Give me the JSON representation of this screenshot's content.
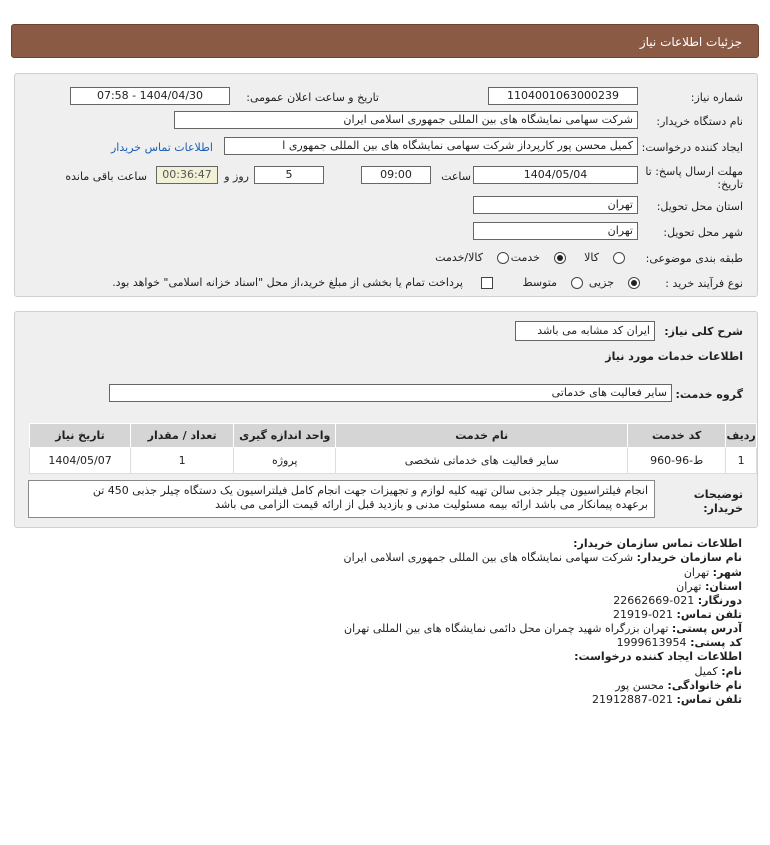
{
  "header": {
    "title": "جزئیات اطلاعات نیاز"
  },
  "form": {
    "need_number_label": "شماره نیاز:",
    "need_number": "1104001063000239",
    "announce_label": "تاریخ و ساعت اعلان عمومی:",
    "announce_value": "1404/04/30 - 07:58",
    "buyer_org_label": "نام دستگاه خریدار:",
    "buyer_org": "شرکت سهامی نمایشگاه های بین المللی جمهوری اسلامی ایران",
    "creator_label": "ایجاد کننده درخواست:",
    "creator": "کمیل محسن پور کارپرداز شرکت سهامی نمایشگاه های بین المللی جمهوری ا",
    "contact_link": "اطلاعات تماس خریدار",
    "deadline_label_1": "مهلت ارسال پاسخ: تا",
    "deadline_label_2": "تاریخ:",
    "deadline_date": "1404/05/04",
    "time_label": "ساعت",
    "deadline_time": "09:00",
    "days_value": "5",
    "days_label": "روز و",
    "remaining": "00:36:47",
    "remaining_label": "ساعت باقی مانده",
    "province_label": "استان محل تحویل:",
    "province": "تهران",
    "city_label": "شهر محل تحویل:",
    "city": "تهران",
    "category_label": "طبقه بندی موضوعی:",
    "category_options": [
      "کالا",
      "خدمت",
      "کالا/خدمت"
    ],
    "category_selected": "خدمت",
    "process_label": "نوع فرآیند خرید :",
    "process_options": [
      "جزیی",
      "متوسط"
    ],
    "process_selected": "جزیی",
    "payment_note": "پرداخت تمام یا بخشی از مبلغ خرید،از محل \"اسناد خزانه اسلامی\" خواهد بود."
  },
  "summary": {
    "label": "شرح کلی نیاز:",
    "value": "ایران کد مشابه می باشد",
    "services_title": "اطلاعات خدمات مورد نیاز",
    "group_label": "گروه خدمت:",
    "group_value": "سایر فعالیت های خدماتی",
    "table": {
      "headers": [
        "ردیف",
        "کد خدمت",
        "نام خدمت",
        "واحد اندازه گیری",
        "تعداد / مقدار",
        "تاریخ نیاز"
      ],
      "rows": [
        [
          "1",
          "ط-96-960",
          "سایر فعالیت های خدماتی شخصی",
          "پروژه",
          "1",
          "1404/05/07"
        ]
      ]
    },
    "buyer_notes_label_1": "توضیحات",
    "buyer_notes_label_2": "خریدار:",
    "buyer_notes_line1": "انجام فیلتراسیون چیلر جذبی سالن تهیه کلیه لوازم و تجهیزات جهت انجام کامل فیلتراسیون یک دستگاه چیلر جذبی 450 تن",
    "buyer_notes_line2": "برعهده پیمانکار می باشد ارائه بیمه مسئولیت مدنی و بازدید قبل از ارائه قیمت الزامی می باشد"
  },
  "contact": {
    "buyer_title": "اطلاعات تماس سازمان خریدار:",
    "org_label": "نام سازمان خریدار:",
    "org_value": "شرکت سهامی نمایشگاه های بین المللی جمهوری اسلامی ایران",
    "city_label": "شهر:",
    "city_value": "تهران",
    "province_label": "استان:",
    "province_value": "تهران",
    "fax_label": "دورنگار:",
    "fax_value": "021-22662669",
    "phone_label": "تلفن تماس:",
    "phone_value": "021-21919",
    "address_label": "آدرس پستی:",
    "address_value": "تهران بزرگراه شهید چمران محل دائمی نمایشگاه های بین المللی تهران",
    "postal_label": "کد پستی:",
    "postal_value": "1999613954",
    "creator_title": "اطلاعات ایجاد کننده درخواست:",
    "name_label": "نام:",
    "name_value": "کمیل",
    "family_label": "نام خانوادگی:",
    "family_value": "محسن پور",
    "creator_phone_label": "تلفن تماس:",
    "creator_phone_value": "021-21912887"
  }
}
